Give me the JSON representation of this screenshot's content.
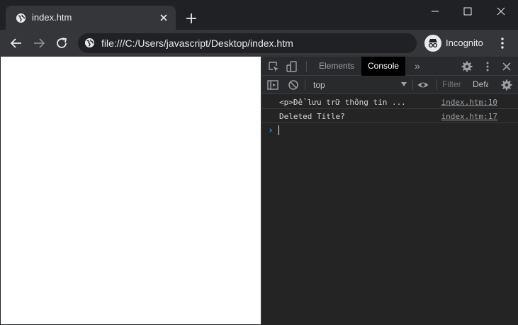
{
  "tab": {
    "title": "index.htm",
    "favicon": "globe-icon"
  },
  "toolbar": {
    "url": "file:///C:/Users/javascript/Desktop/index.htm",
    "profile_label": "Incognito"
  },
  "devtools": {
    "tabs": [
      {
        "label": "Elements",
        "active": false
      },
      {
        "label": "Console",
        "active": true
      }
    ],
    "more_tabs": "»",
    "context": "top",
    "filter_placeholder": "Filter",
    "levels_label": "Default levels",
    "logs": [
      {
        "message": "<p>Để lưu trữ thông tin ...",
        "source": "index.htm:10"
      },
      {
        "message": "Deleted Title?",
        "source": "index.htm:17"
      }
    ],
    "prompt": "›"
  },
  "colors": {
    "frame": "#202124",
    "toolbar": "#35363a",
    "devtools_bg": "#242424",
    "prompt_accent": "#3d8df5"
  }
}
